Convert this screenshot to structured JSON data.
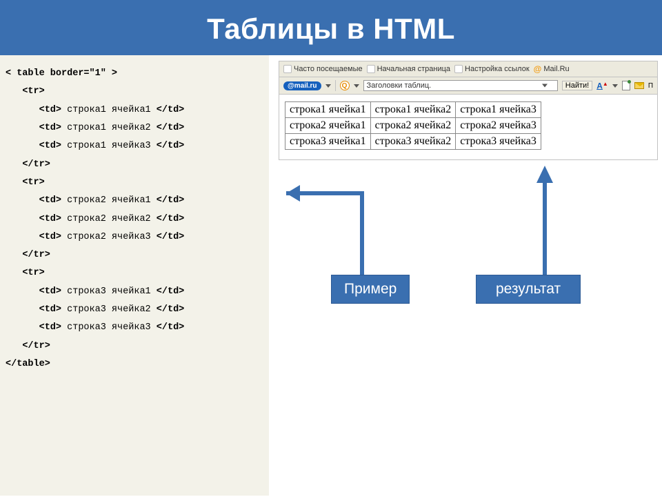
{
  "header": "Таблицы в HTML",
  "code": {
    "table_open": "< table border=\"1\" >",
    "tr_open": "<tr>",
    "tr_close": "</tr>",
    "table_close": "</table>",
    "td_open": "<td>",
    "td_close": "</td>",
    "rows": [
      [
        "строка1 ячейка1",
        "строка1 ячейка2",
        "строка1 ячейка3"
      ],
      [
        "строка2 ячейка1",
        "строка2 ячейка2",
        "строка2 ячейка3"
      ],
      [
        "строка3 ячейка1",
        "строка3 ячейка2",
        "строка3 ячейка3"
      ]
    ]
  },
  "browser": {
    "bookmarks": {
      "freq": "Часто посещаемые",
      "start": "Начальная страница",
      "links": "Настройка ссылок",
      "mail": "Mail.Ru"
    },
    "mail_badge": "@mail.ru",
    "search_value": "Заголовки таблиц.",
    "find_btn": "Найти!",
    "a_icon": "A",
    "po": "П"
  },
  "result_table": [
    [
      "строка1 ячейка1",
      "строка1 ячейка2",
      "строка1 ячейка3"
    ],
    [
      "строка2 ячейка1",
      "строка2 ячейка2",
      "строка2 ячейка3"
    ],
    [
      "строка3 ячейка1",
      "строка3 ячейка2",
      "строка3 ячейка3"
    ]
  ],
  "labels": {
    "example": "Пример",
    "result": "результат"
  }
}
